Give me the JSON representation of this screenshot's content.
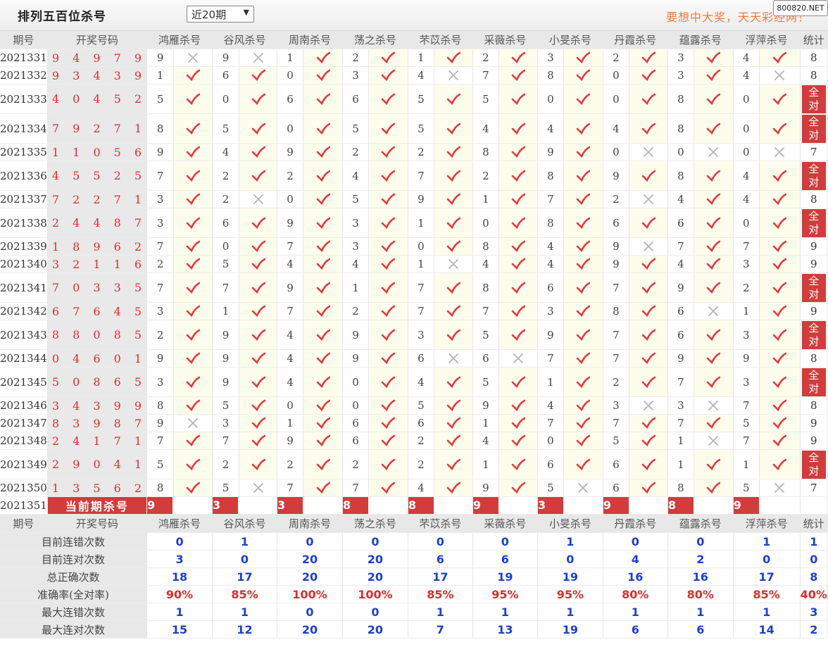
{
  "header": {
    "title": "排列五百位杀号",
    "period_select": "近20期",
    "slogan": "要想中大奖，天天彩经网！",
    "badge": "800820.NET"
  },
  "columns": {
    "period": "期号",
    "draw": "开奖号码",
    "experts": [
      "鸿雁杀号",
      "谷风杀号",
      "周南杀号",
      "荡之杀号",
      "芣苡杀号",
      "采薇杀号",
      "小旻杀号",
      "丹霞杀号",
      "蕴露杀号",
      "浮萍杀号"
    ],
    "stat": "统计"
  },
  "all_correct_label": "全对",
  "rows": [
    {
      "period": "2021331",
      "draw": "94979",
      "kills": [
        9,
        9,
        1,
        2,
        1,
        2,
        3,
        2,
        3,
        4
      ],
      "hits": [
        0,
        0,
        1,
        1,
        1,
        1,
        1,
        1,
        1,
        1
      ],
      "stat": "8"
    },
    {
      "period": "2021332",
      "draw": "93439",
      "kills": [
        1,
        6,
        0,
        3,
        4,
        7,
        8,
        0,
        3,
        4
      ],
      "hits": [
        1,
        1,
        1,
        1,
        0,
        1,
        1,
        1,
        1,
        0
      ],
      "stat": "8"
    },
    {
      "period": "2021333",
      "draw": "40452",
      "kills": [
        5,
        0,
        6,
        6,
        5,
        5,
        0,
        0,
        8,
        0
      ],
      "hits": [
        1,
        1,
        1,
        1,
        1,
        1,
        1,
        1,
        1,
        1
      ],
      "stat": "全对"
    },
    {
      "period": "2021334",
      "draw": "79271",
      "kills": [
        8,
        5,
        0,
        5,
        5,
        4,
        4,
        4,
        8,
        0
      ],
      "hits": [
        1,
        1,
        1,
        1,
        1,
        1,
        1,
        1,
        1,
        1
      ],
      "stat": "全对"
    },
    {
      "period": "2021335",
      "draw": "11056",
      "kills": [
        9,
        4,
        9,
        2,
        2,
        8,
        9,
        0,
        0,
        0
      ],
      "hits": [
        1,
        1,
        1,
        1,
        1,
        1,
        1,
        0,
        0,
        0
      ],
      "stat": "7"
    },
    {
      "period": "2021336",
      "draw": "45525",
      "kills": [
        7,
        2,
        2,
        4,
        7,
        2,
        8,
        9,
        8,
        4
      ],
      "hits": [
        1,
        1,
        1,
        1,
        1,
        1,
        1,
        1,
        1,
        1
      ],
      "stat": "全对"
    },
    {
      "period": "2021337",
      "draw": "72271",
      "kills": [
        3,
        2,
        0,
        5,
        9,
        1,
        7,
        2,
        4,
        4
      ],
      "hits": [
        1,
        0,
        1,
        1,
        1,
        1,
        1,
        0,
        1,
        1
      ],
      "stat": "8"
    },
    {
      "period": "2021338",
      "draw": "24487",
      "kills": [
        3,
        6,
        9,
        3,
        1,
        0,
        8,
        6,
        6,
        0
      ],
      "hits": [
        1,
        1,
        1,
        1,
        1,
        1,
        1,
        1,
        1,
        1
      ],
      "stat": "全对"
    },
    {
      "period": "2021339",
      "draw": "18962",
      "kills": [
        7,
        0,
        7,
        3,
        0,
        8,
        4,
        9,
        7,
        7
      ],
      "hits": [
        1,
        1,
        1,
        1,
        1,
        1,
        1,
        0,
        1,
        1
      ],
      "stat": "9"
    },
    {
      "period": "2021340",
      "draw": "32116",
      "kills": [
        2,
        5,
        4,
        4,
        1,
        4,
        4,
        9,
        4,
        3
      ],
      "hits": [
        1,
        1,
        1,
        1,
        0,
        1,
        1,
        1,
        1,
        1
      ],
      "stat": "9"
    },
    {
      "period": "2021341",
      "draw": "70335",
      "kills": [
        7,
        7,
        9,
        1,
        7,
        8,
        6,
        7,
        9,
        2
      ],
      "hits": [
        1,
        1,
        1,
        1,
        1,
        1,
        1,
        1,
        1,
        1
      ],
      "stat": "全对"
    },
    {
      "period": "2021342",
      "draw": "67645",
      "kills": [
        3,
        1,
        7,
        2,
        7,
        7,
        3,
        8,
        6,
        1
      ],
      "hits": [
        1,
        1,
        1,
        1,
        1,
        1,
        1,
        1,
        0,
        1
      ],
      "stat": "9"
    },
    {
      "period": "2021343",
      "draw": "88085",
      "kills": [
        2,
        9,
        4,
        9,
        3,
        5,
        9,
        7,
        6,
        3
      ],
      "hits": [
        1,
        1,
        1,
        1,
        1,
        1,
        1,
        1,
        1,
        1
      ],
      "stat": "全对"
    },
    {
      "period": "2021344",
      "draw": "04601",
      "kills": [
        9,
        9,
        4,
        9,
        6,
        6,
        7,
        7,
        9,
        9
      ],
      "hits": [
        1,
        1,
        1,
        1,
        0,
        0,
        1,
        1,
        1,
        1
      ],
      "stat": "8"
    },
    {
      "period": "2021345",
      "draw": "50865",
      "kills": [
        3,
        9,
        4,
        0,
        4,
        5,
        1,
        2,
        7,
        3
      ],
      "hits": [
        1,
        1,
        1,
        1,
        1,
        1,
        1,
        1,
        1,
        1
      ],
      "stat": "全对"
    },
    {
      "period": "2021346",
      "draw": "34399",
      "kills": [
        8,
        5,
        0,
        0,
        5,
        9,
        4,
        3,
        3,
        7
      ],
      "hits": [
        1,
        1,
        1,
        1,
        1,
        1,
        1,
        0,
        0,
        1
      ],
      "stat": "8"
    },
    {
      "period": "2021347",
      "draw": "83987",
      "kills": [
        9,
        3,
        1,
        6,
        6,
        1,
        7,
        7,
        7,
        5
      ],
      "hits": [
        0,
        1,
        1,
        1,
        1,
        1,
        1,
        1,
        1,
        1
      ],
      "stat": "9"
    },
    {
      "period": "2021348",
      "draw": "24171",
      "kills": [
        7,
        7,
        9,
        6,
        2,
        4,
        0,
        5,
        1,
        7
      ],
      "hits": [
        1,
        1,
        1,
        1,
        1,
        1,
        1,
        1,
        0,
        1
      ],
      "stat": "9"
    },
    {
      "period": "2021349",
      "draw": "29041",
      "kills": [
        5,
        2,
        2,
        2,
        2,
        1,
        6,
        6,
        1,
        1
      ],
      "hits": [
        1,
        1,
        1,
        1,
        1,
        1,
        1,
        1,
        1,
        1
      ],
      "stat": "全对"
    },
    {
      "period": "2021350",
      "draw": "13562",
      "kills": [
        8,
        5,
        7,
        7,
        4,
        9,
        5,
        6,
        8,
        5
      ],
      "hits": [
        1,
        0,
        1,
        1,
        1,
        1,
        0,
        1,
        1,
        0
      ],
      "stat": "7"
    }
  ],
  "current": {
    "period": "2021351",
    "label": "当前期杀号",
    "kills": [
      9,
      3,
      3,
      8,
      8,
      9,
      3,
      9,
      8,
      9
    ]
  },
  "summary": [
    {
      "label": "目前连错次数",
      "values": [
        "0",
        "1",
        "0",
        "0",
        "0",
        "0",
        "1",
        "0",
        "0",
        "1",
        "1"
      ],
      "red": false
    },
    {
      "label": "目前连对次数",
      "values": [
        "3",
        "0",
        "20",
        "20",
        "6",
        "6",
        "0",
        "4",
        "2",
        "0",
        "0"
      ],
      "red": false
    },
    {
      "label": "总正确次数",
      "values": [
        "18",
        "17",
        "20",
        "20",
        "17",
        "19",
        "19",
        "16",
        "16",
        "17",
        "8"
      ],
      "red": false
    },
    {
      "label": "准确率(全对率)",
      "values": [
        "90%",
        "85%",
        "100%",
        "100%",
        "85%",
        "95%",
        "95%",
        "80%",
        "80%",
        "85%",
        "40%"
      ],
      "red": true
    },
    {
      "label": "最大连错次数",
      "values": [
        "1",
        "1",
        "0",
        "0",
        "1",
        "1",
        "1",
        "1",
        "1",
        "1",
        "3"
      ],
      "red": false
    },
    {
      "label": "最大连对次数",
      "values": [
        "15",
        "12",
        "20",
        "20",
        "7",
        "13",
        "19",
        "6",
        "6",
        "14",
        "2"
      ],
      "red": false
    }
  ],
  "colors": {
    "check": "#e8383d",
    "cross": "#b5b5b5",
    "accent": "#d23c3c",
    "blue": "#1e3fcf"
  }
}
